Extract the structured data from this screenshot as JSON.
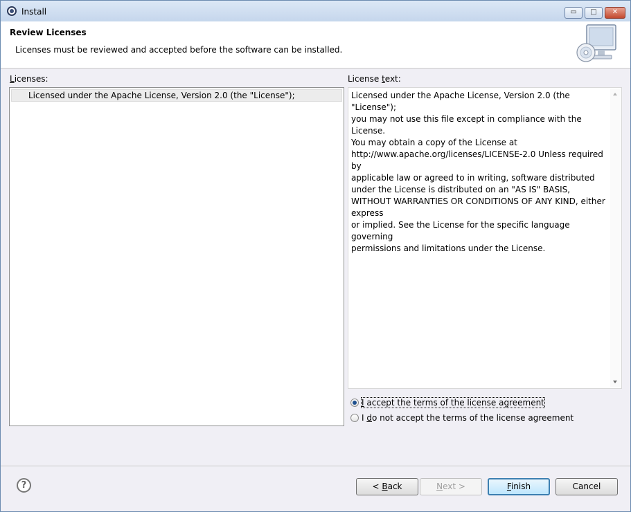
{
  "window": {
    "title": "Install",
    "controls": {
      "minimize": "▭",
      "maximize": "□",
      "close": "✕"
    }
  },
  "header": {
    "title": "Review Licenses",
    "description": "Licenses must be reviewed and accepted before the software can be installed.",
    "icon": "monitor-cd-icon"
  },
  "licenses": {
    "label_pre": "",
    "label_mnemonic": "L",
    "label_post": "icenses:",
    "items": [
      "Licensed under the Apache License, Version 2.0 (the \"License\");"
    ]
  },
  "license_text": {
    "label_pre": "License ",
    "label_mnemonic": "t",
    "label_post": "ext:",
    "body": "Licensed under the Apache License, Version 2.0 (the \"License\");\nyou may not use this file except in compliance with the License.\nYou may obtain a copy of the License at\nhttp://www.apache.org/licenses/LICENSE-2.0 Unless required\nby\napplicable law or agreed to in writing, software distributed\nunder the License is distributed on an \"AS IS\" BASIS,\nWITHOUT WARRANTIES OR CONDITIONS OF ANY KIND, either\nexpress\nor implied. See the License for the specific language governing\npermissions and limitations under the License."
  },
  "radios": {
    "accept": {
      "pre": "",
      "mnemonic": "I",
      "post": " accept the terms of the license agreement",
      "selected": true
    },
    "decline": {
      "pre": "I ",
      "mnemonic": "d",
      "post": "o not accept the terms of the license agreement",
      "selected": false
    }
  },
  "footer": {
    "help_icon": "?",
    "back": {
      "pre": "< ",
      "mnemonic": "B",
      "post": "ack"
    },
    "next": {
      "pre": "",
      "mnemonic": "N",
      "post": "ext >"
    },
    "finish": {
      "pre": "",
      "mnemonic": "F",
      "post": "inish"
    },
    "cancel": "Cancel"
  },
  "colors": {
    "accent": "#3c7fb1",
    "selected_radio": "#1e4f8e"
  }
}
